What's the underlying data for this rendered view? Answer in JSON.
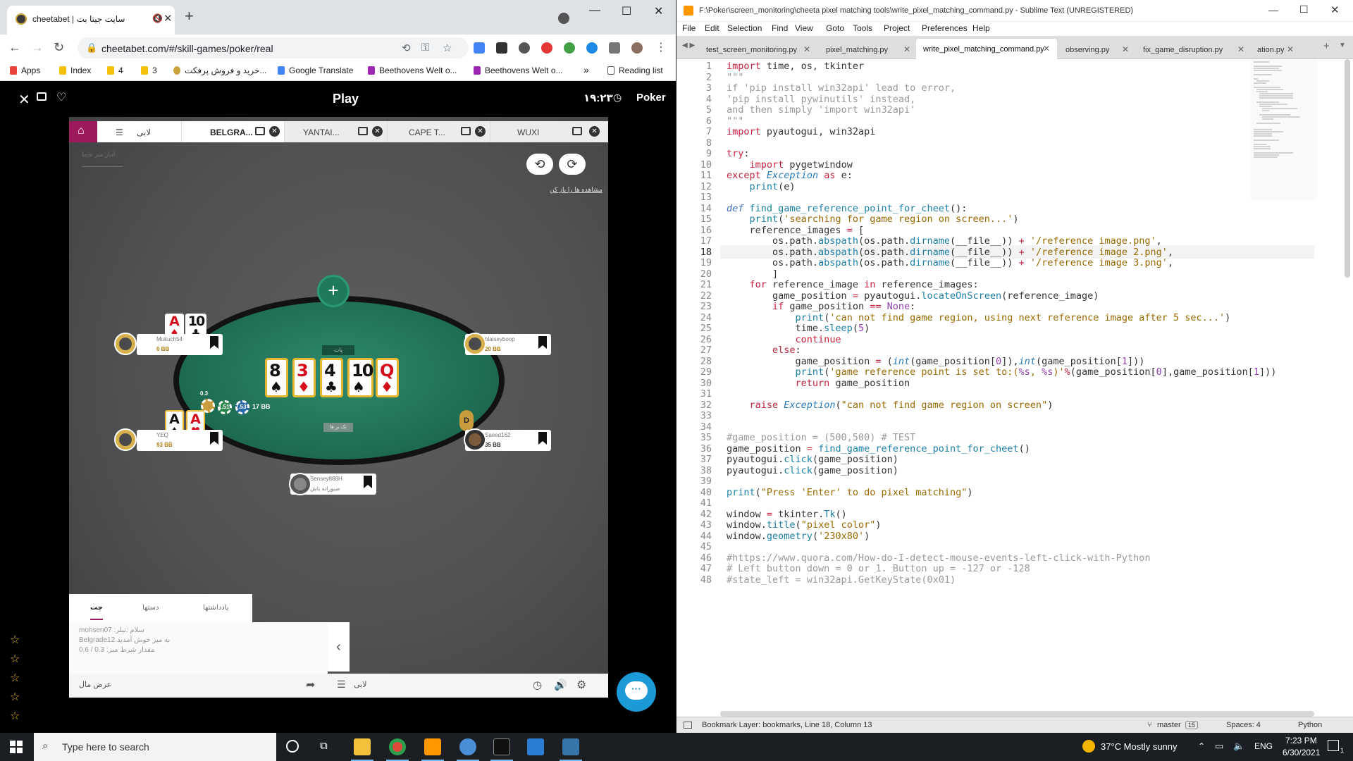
{
  "chrome": {
    "tab_title": "سایت جیتا بت | cheetabet",
    "new_tab": "+",
    "url": "cheetabet.com/#/skill-games/poker/real",
    "bookmarks": [
      {
        "label": "Apps",
        "color": "#e8453c"
      },
      {
        "label": "Index",
        "color": "#f4c20d"
      },
      {
        "label": "4",
        "color": "#f4c20d"
      },
      {
        "label": "3",
        "color": "#f4c20d"
      },
      {
        "label": "خرید و فروش پرفکت...",
        "color": "#c9a23a"
      },
      {
        "label": "Google Translate",
        "color": "#4285f4"
      },
      {
        "label": "Beethovens Welt o...",
        "color": "#9c27b0"
      },
      {
        "label": "Beethovens Welt o...",
        "color": "#9c27b0"
      }
    ],
    "more_bookmarks": "»",
    "reading_list": "Reading list"
  },
  "web": {
    "title": "Play",
    "time": "۱۹:۲۳",
    "brand": "Poker",
    "game_tabs": [
      {
        "label": "لابی"
      },
      {
        "label": "BELGRA..."
      },
      {
        "label": "YANTAI..."
      },
      {
        "label": "CAPE T..."
      },
      {
        "label": "WUXI"
      }
    ],
    "faint_top_left": "آمار میز شما",
    "watch_link": "مشاهده ها را باز کن",
    "pot_label": "پات",
    "board": [
      {
        "rank": "8",
        "suit": "♠",
        "color": "black"
      },
      {
        "rank": "3",
        "suit": "♦",
        "color": "red"
      },
      {
        "rank": "4",
        "suit": "♣",
        "color": "black"
      },
      {
        "rank": "10",
        "suit": "♠",
        "color": "black"
      },
      {
        "rank": "Q",
        "suit": "♦",
        "color": "red"
      }
    ],
    "seats": {
      "mukuch": {
        "name": "Mukuch54",
        "stack": "0 BB",
        "cards": [
          {
            "rank": "A",
            "suit": "♦",
            "color": "red"
          },
          {
            "rank": "10",
            "suit": "♣",
            "color": "black"
          }
        ]
      },
      "yeq": {
        "name": "YEQ",
        "stack": "93 BB",
        "cards": [
          {
            "rank": "A",
            "suit": "♠",
            "color": "black"
          },
          {
            "rank": "A",
            "suit": "♥",
            "color": "red"
          }
        ]
      },
      "blaise": {
        "name": "blaiseyboop",
        "stack": "20 BB"
      },
      "saeed": {
        "name": "Saeed162",
        "stack": "35 BB"
      },
      "hero": {
        "name": "Sensey888H",
        "stack": "صبورانه باش"
      }
    },
    "dealer_button": "D",
    "chip_values": [
      "0.3",
      "1.51",
      "7.53"
    ],
    "bet_amount": "17 BB",
    "center_label": "تک بر ها",
    "chat_tabs": [
      "یادداشتها",
      "دستها",
      "چت"
    ],
    "chat_lines": [
      "mohsen07 :سلام :تیلر",
      "Belgrade12 به میز خوش آمدید",
      "مقدار شرط میز: 0.3 / 0.6"
    ],
    "bottom_left": "عرض مال",
    "bottom_lobby": "لابی"
  },
  "sublime": {
    "title": "F:\\Poker\\screen_monitoring\\cheeta pixel matching tools\\write_pixel_matching_command.py - Sublime Text (UNREGISTERED)",
    "menu": [
      "File",
      "Edit",
      "Selection",
      "Find",
      "View",
      "Goto",
      "Tools",
      "Project",
      "Preferences",
      "Help"
    ],
    "tabs": [
      "test_screen_monitoring.py",
      "pixel_matching.py",
      "write_pixel_matching_command.py",
      "observing.py",
      "fix_game_disruption.py",
      "ation.py"
    ],
    "status": {
      "left": "Bookmark Layer: bookmarks, Line 18, Column 13",
      "branch": "master",
      "branch_count": "15",
      "spaces": "Spaces: 4",
      "syntax": "Python"
    }
  },
  "taskbar": {
    "search_placeholder": "Type here to search",
    "weather": "37°C  Mostly sunny",
    "lang": "ENG",
    "time": "7:23 PM",
    "date": "6/30/2021",
    "notif": "1"
  }
}
